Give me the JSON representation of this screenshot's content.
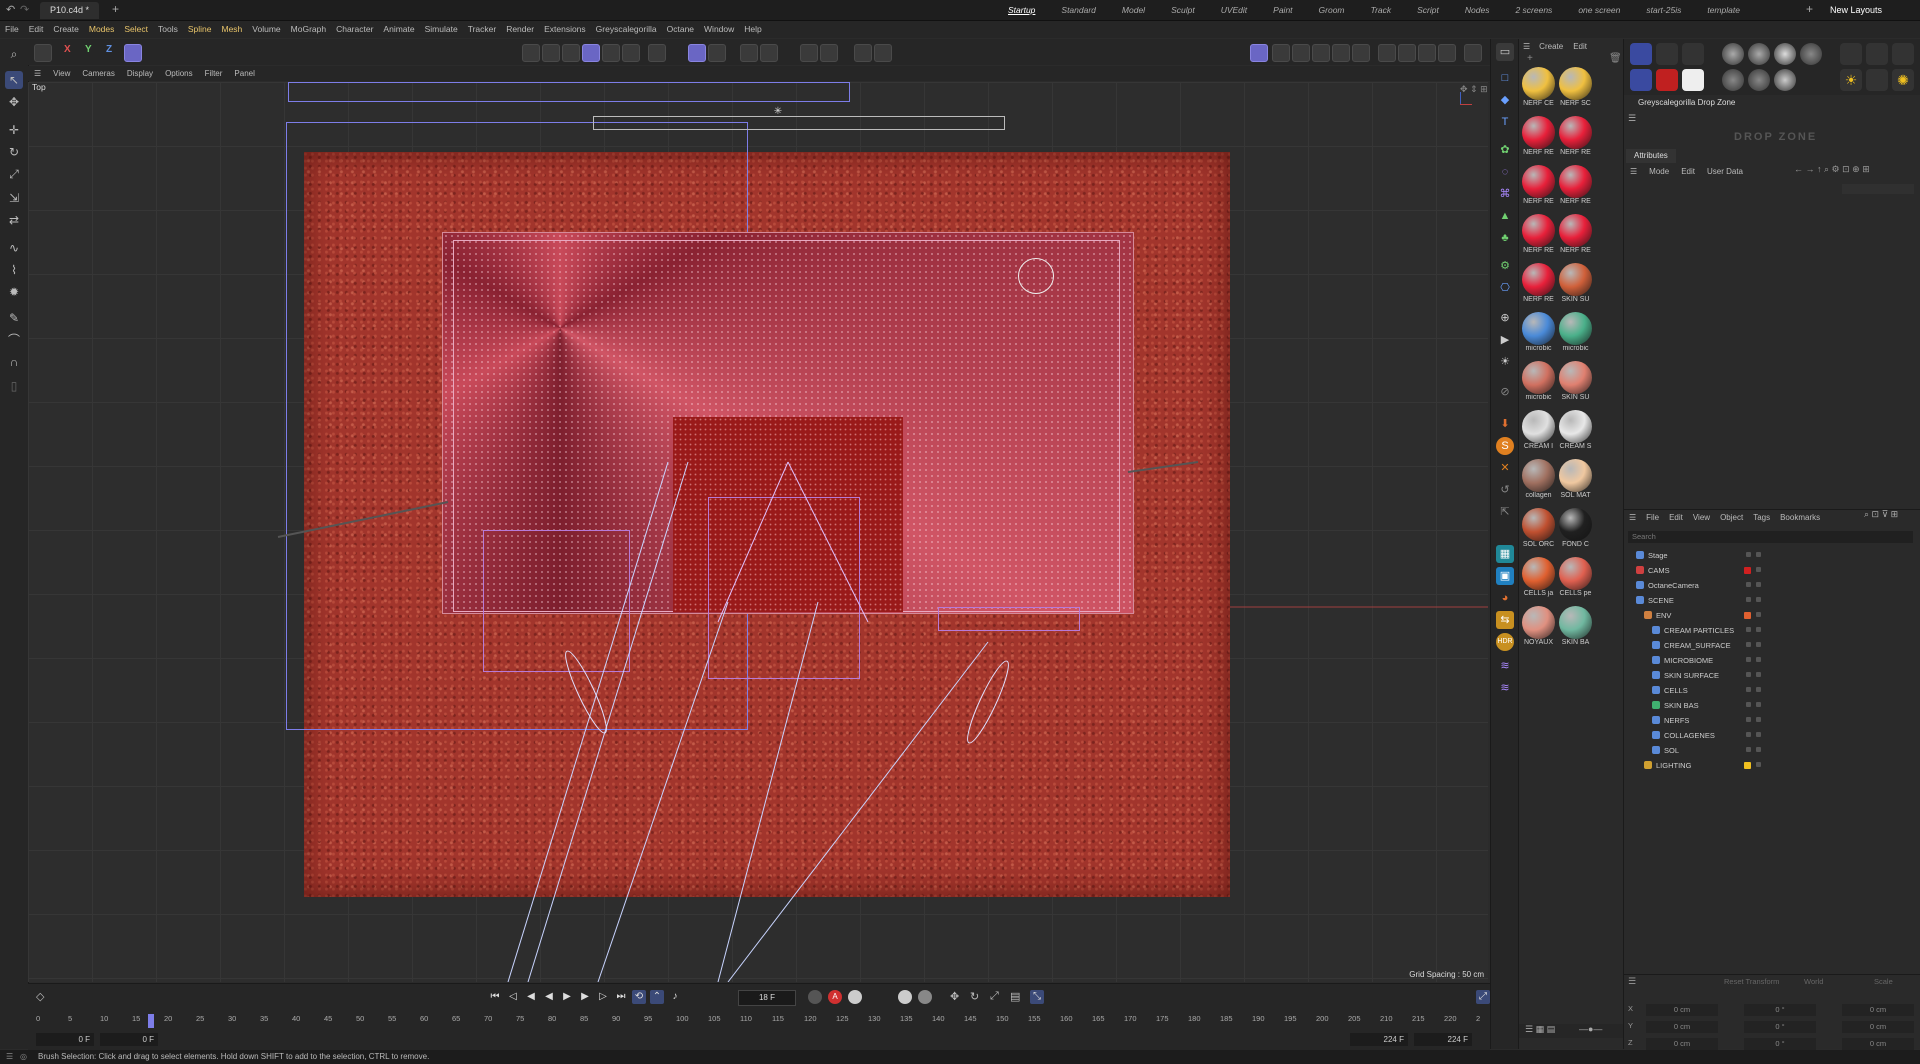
{
  "titlebar": {
    "doc_tab": "P10.c4d *",
    "layouts": [
      "Startup",
      "Standard",
      "Model",
      "Sculpt",
      "UVEdit",
      "Paint",
      "Groom",
      "Track",
      "Script",
      "Nodes",
      "2 screens",
      "one screen",
      "start-25is",
      "template"
    ],
    "active_layout": "Startup",
    "new_layouts": "New Layouts"
  },
  "menubar": [
    "File",
    "Edit",
    "Create",
    "Modes",
    "Select",
    "Tools",
    "Spline",
    "Mesh",
    "Volume",
    "MoGraph",
    "Character",
    "Animate",
    "Simulate",
    "Tracker",
    "Render",
    "Extensions",
    "Greyscalegorilla",
    "Octane",
    "Window",
    "Help"
  ],
  "viewport": {
    "menu": [
      "View",
      "Cameras",
      "Display",
      "Options",
      "Filter",
      "Panel"
    ],
    "view_name": "Top",
    "grid_spacing": "Grid Spacing : 50 cm"
  },
  "timeline": {
    "current_frame": "18 F",
    "ticks": [
      "0",
      "5",
      "10",
      "15",
      "20",
      "25",
      "30",
      "35",
      "40",
      "45",
      "50",
      "55",
      "60",
      "65",
      "70",
      "75",
      "80",
      "85",
      "90",
      "95",
      "100",
      "105",
      "110",
      "115",
      "120",
      "125",
      "130",
      "135",
      "140",
      "145",
      "150",
      "155",
      "160",
      "165",
      "170",
      "175",
      "180",
      "185",
      "190",
      "195",
      "200",
      "205",
      "210",
      "215",
      "220",
      "2"
    ],
    "start_field": "0 F",
    "start_field2": "0 F",
    "end_field": "224 F",
    "end_field2": "224 F"
  },
  "status": "Brush Selection: Click and drag to select elements. Hold down SHIFT to add to the selection, CTRL to remove.",
  "material_manager": {
    "menu": [
      "Create",
      "Edit"
    ],
    "materials": [
      {
        "label": "NERF CE",
        "color": "#f0c040"
      },
      {
        "label": "NERF SC",
        "color": "#f0c040"
      },
      {
        "label": "NERF RE",
        "color": "#e8203a"
      },
      {
        "label": "NERF RE",
        "color": "#e8203a"
      },
      {
        "label": "NERF RE",
        "color": "#e8203a"
      },
      {
        "label": "NERF RE",
        "color": "#e8203a"
      },
      {
        "label": "NERF RE",
        "color": "#e8203a"
      },
      {
        "label": "NERF RE",
        "color": "#e8203a"
      },
      {
        "label": "NERF RE",
        "color": "#e8203a"
      },
      {
        "label": "SKIN SU",
        "color": "#d0603a"
      },
      {
        "label": "microbic",
        "color": "#4a8ad8"
      },
      {
        "label": "microbic",
        "color": "#4ab08a"
      },
      {
        "label": "microbic",
        "color": "#d07060"
      },
      {
        "label": "SKIN SU",
        "color": "#e08070"
      },
      {
        "label": "CREAM I",
        "color": "#e0e0e0"
      },
      {
        "label": "CREAM S",
        "color": "#e8e8e8"
      },
      {
        "label": "collagen",
        "color": "#a07060"
      },
      {
        "label": "SOL MAT",
        "color": "#f0c8a0"
      },
      {
        "label": "SOL ORC",
        "color": "#c05030"
      },
      {
        "label": "FOND C",
        "color": "#202020"
      },
      {
        "label": "CELLS ja",
        "color": "#e06030"
      },
      {
        "label": "CELLS pe",
        "color": "#e06050"
      },
      {
        "label": "NOYAUX",
        "color": "#e09080"
      },
      {
        "label": "SKIN BA",
        "color": "#70b8a0"
      }
    ]
  },
  "right": {
    "dropzone_title": "Greyscalegorilla Drop Zone",
    "dropzone_logo": "DROP ZONE",
    "attributes_tab": "Attributes",
    "attr_menu": [
      "Mode",
      "Edit",
      "User Data"
    ],
    "obj_menu": [
      "File",
      "Edit",
      "View",
      "Object",
      "Tags",
      "Bookmarks"
    ],
    "search_placeholder": "Search",
    "objects": [
      {
        "name": "Stage",
        "indent": 0,
        "tag": "",
        "icon": "#5a8ad8"
      },
      {
        "name": "CAMS",
        "indent": 0,
        "tag": "#d02020",
        "icon": "#d04040"
      },
      {
        "name": "OctaneCamera",
        "indent": 0,
        "tag": "",
        "icon": "#5a8ad8"
      },
      {
        "name": "SCENE",
        "indent": 0,
        "tag": "",
        "icon": "#5a8ad8"
      },
      {
        "name": "ENV",
        "indent": 1,
        "tag": "#e06030",
        "icon": "#d08040"
      },
      {
        "name": "CREAM PARTICLES",
        "indent": 2,
        "tag": "",
        "icon": "#5a8ad8"
      },
      {
        "name": "CREAM_SURFACE",
        "indent": 2,
        "tag": "",
        "icon": "#5a8ad8"
      },
      {
        "name": "MICROBIOME",
        "indent": 2,
        "tag": "",
        "icon": "#5a8ad8"
      },
      {
        "name": "SKIN SURFACE",
        "indent": 2,
        "tag": "",
        "icon": "#5a8ad8"
      },
      {
        "name": "CELLS",
        "indent": 2,
        "tag": "",
        "icon": "#5a8ad8"
      },
      {
        "name": "SKIN BAS",
        "indent": 2,
        "tag": "",
        "icon": "#40b070"
      },
      {
        "name": "NERFS",
        "indent": 2,
        "tag": "",
        "icon": "#5a8ad8"
      },
      {
        "name": "COLLAGENES",
        "indent": 2,
        "tag": "",
        "icon": "#5a8ad8"
      },
      {
        "name": "SOL",
        "indent": 2,
        "tag": "",
        "icon": "#5a8ad8"
      },
      {
        "name": "LIGHTING",
        "indent": 1,
        "tag": "#f0c020",
        "icon": "#d0a030"
      }
    ],
    "coord_head": [
      "Reset Transform",
      "World",
      "Scale"
    ],
    "coords": [
      {
        "axis": "X",
        "pos": "0 cm",
        "rot": "0 °",
        "size": "0 cm"
      },
      {
        "axis": "Y",
        "pos": "0 cm",
        "rot": "0 °",
        "size": "0 cm"
      },
      {
        "axis": "Z",
        "pos": "0 cm",
        "rot": "0 °",
        "size": "0 cm"
      }
    ]
  }
}
